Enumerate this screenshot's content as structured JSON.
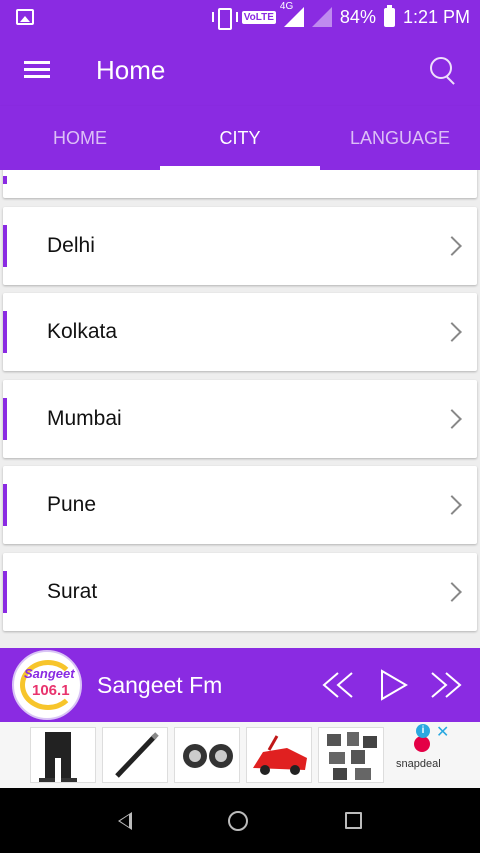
{
  "status_bar": {
    "network": "4G",
    "volte": "VoLTE",
    "battery": "84%",
    "time": "1:21 PM"
  },
  "app_bar": {
    "title": "Home"
  },
  "tabs": [
    {
      "label": "HOME",
      "active": false
    },
    {
      "label": "CITY",
      "active": true
    },
    {
      "label": "LANGUAGE",
      "active": false
    }
  ],
  "cities": [
    {
      "label": "Delhi"
    },
    {
      "label": "Kolkata"
    },
    {
      "label": "Mumbai"
    },
    {
      "label": "Pune"
    },
    {
      "label": "Surat"
    }
  ],
  "player": {
    "station_name": "Sangeet Fm",
    "logo_text": "Sangeet",
    "logo_freq": "106.1"
  },
  "ad": {
    "brand": "snapdeal"
  },
  "colors": {
    "primary": "#8a2be2",
    "accent_bar": "#8a2be2"
  }
}
